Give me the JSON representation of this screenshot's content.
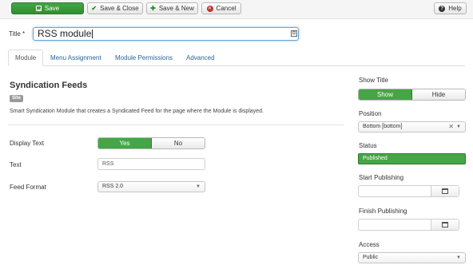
{
  "toolbar": {
    "save_label": "Save",
    "save_close_label": "Save & Close",
    "save_new_label": "Save & New",
    "cancel_label": "Cancel",
    "help_label": "Help"
  },
  "title": {
    "label": "Title *",
    "value": "RSS module"
  },
  "tabs": [
    "Module",
    "Menu Assignment",
    "Module Permissions",
    "Advanced"
  ],
  "module": {
    "heading": "Syndication Feeds",
    "badge": "Site",
    "description": "Smart Syndication Module that creates a Syndicated Feed for the page where the Module is displayed.",
    "display_text": {
      "label": "Display Text",
      "yes": "Yes",
      "no": "No",
      "selected": "Yes"
    },
    "text": {
      "label": "Text",
      "value": "RSS"
    },
    "feed_format": {
      "label": "Feed Format",
      "value": "RSS 2.0"
    }
  },
  "sidebar": {
    "show_title": {
      "label": "Show Title",
      "show": "Show",
      "hide": "Hide",
      "selected": "Show"
    },
    "position": {
      "label": "Position",
      "value": "Bottom [bottom]"
    },
    "status": {
      "label": "Status",
      "value": "Published"
    },
    "start_publishing": {
      "label": "Start Publishing",
      "value": ""
    },
    "finish_publishing": {
      "label": "Finish Publishing",
      "value": ""
    },
    "access": {
      "label": "Access",
      "value": "Public"
    }
  },
  "colors": {
    "accent_green": "#46a546",
    "link_blue": "#2a6496"
  },
  "icons": [
    "save-icon",
    "check-icon",
    "plus-icon",
    "cancel-icon",
    "help-icon",
    "calendar-icon",
    "chevron-down-icon",
    "clear-icon"
  ]
}
